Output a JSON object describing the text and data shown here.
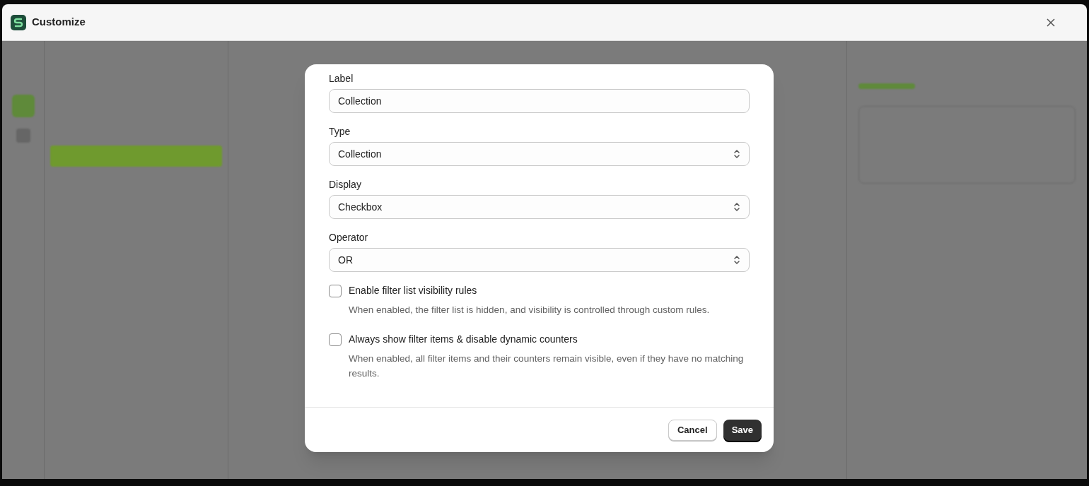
{
  "window": {
    "title": "Customize"
  },
  "dialog": {
    "fields": [
      {
        "kind": "text",
        "label": "Label",
        "value": "Collection"
      },
      {
        "kind": "select",
        "label": "Type",
        "value": "Collection"
      },
      {
        "kind": "select",
        "label": "Display",
        "value": "Checkbox"
      },
      {
        "kind": "select",
        "label": "Operator",
        "value": "OR"
      }
    ],
    "options": [
      {
        "label": "Enable filter list visibility rules",
        "checked": false,
        "description": "When enabled, the filter list is hidden, and visibility is controlled through custom rules."
      },
      {
        "label": "Always show filter items & disable dynamic counters",
        "checked": false,
        "description": "When enabled, all filter items and their counters remain visible, even if they have no matching results."
      }
    ],
    "buttons": [
      {
        "label": "Cancel",
        "kind": "secondary"
      },
      {
        "label": "Save",
        "kind": "primary"
      }
    ]
  }
}
